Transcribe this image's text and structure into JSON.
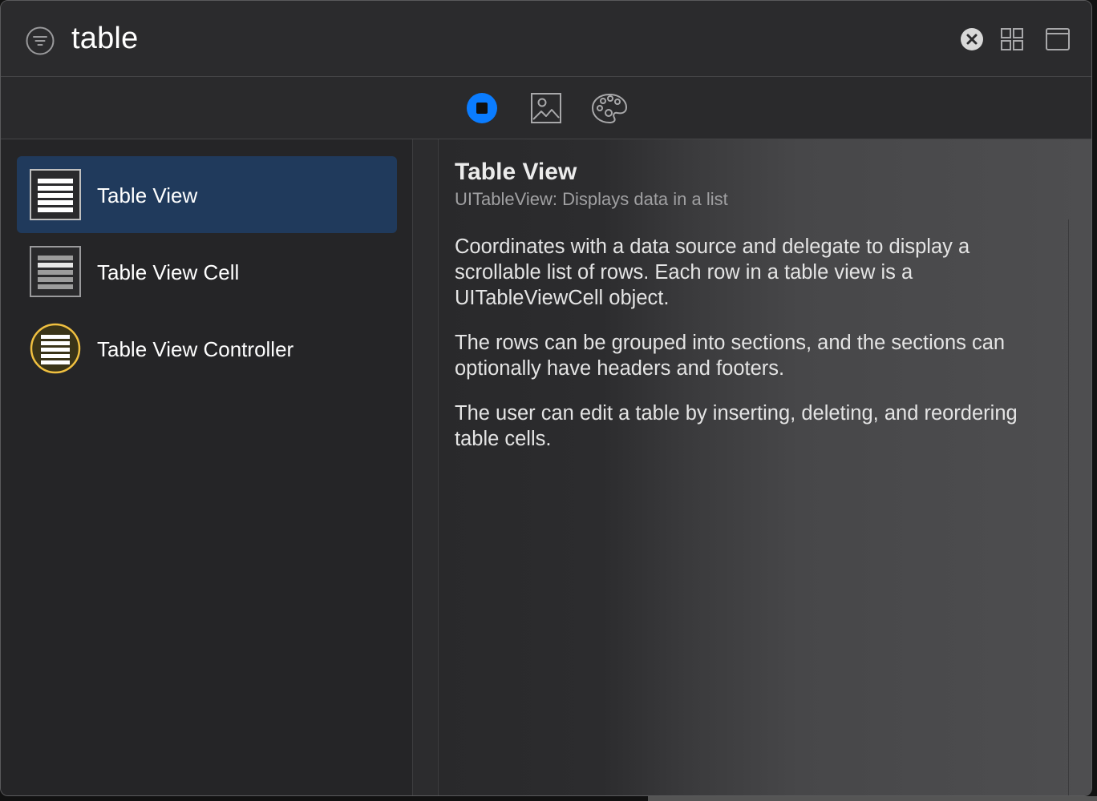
{
  "search": {
    "query": "table"
  },
  "library_tabs": [
    {
      "name": "objects",
      "icon": "object-square-icon",
      "selected": true
    },
    {
      "name": "media",
      "icon": "photo-icon",
      "selected": false
    },
    {
      "name": "colors",
      "icon": "palette-icon",
      "selected": false
    }
  ],
  "results": [
    {
      "label": "Table View",
      "icon": "table-view-icon",
      "selected": true
    },
    {
      "label": "Table View Cell",
      "icon": "table-view-cell-icon",
      "selected": false
    },
    {
      "label": "Table View Controller",
      "icon": "table-view-controller-icon",
      "selected": false
    }
  ],
  "detail": {
    "title": "Table View",
    "subtitle": "UITableView: Displays data in a list",
    "paragraphs": [
      "Coordinates with a data source and delegate to display a scrollable list of rows. Each row in a table view is a UITableViewCell object.",
      "The rows can be grouped into sections, and the sections can optionally have headers and footers.",
      "The user can edit a table by inserting, deleting, and reordering table cells."
    ]
  },
  "colors": {
    "accent": "#0a7cff",
    "selection": "#203a5c",
    "controller_ring": "#f0c040"
  }
}
